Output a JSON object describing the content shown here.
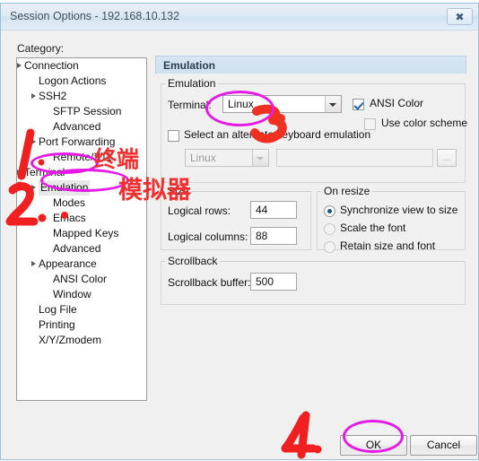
{
  "window": {
    "title": "Session Options  -  192.168.10.132",
    "close_icon": "close-icon",
    "close_glyph": "✖"
  },
  "sidebar": {
    "label": "Category:",
    "items": [
      {
        "label": "Connection",
        "depth": 0,
        "expander": true,
        "selected": false
      },
      {
        "label": "Logon Actions",
        "depth": 1,
        "expander": false,
        "selected": false
      },
      {
        "label": "SSH2",
        "depth": 1,
        "expander": true,
        "selected": false
      },
      {
        "label": "SFTP Session",
        "depth": 2,
        "expander": false,
        "selected": false
      },
      {
        "label": "Advanced",
        "depth": 2,
        "expander": false,
        "selected": false
      },
      {
        "label": "Port Forwarding",
        "depth": 1,
        "expander": true,
        "selected": false
      },
      {
        "label": "Remote/X11",
        "depth": 2,
        "expander": false,
        "selected": false
      },
      {
        "label": "Terminal",
        "depth": 0,
        "expander": true,
        "selected": false
      },
      {
        "label": "Emulation",
        "depth": 1,
        "expander": true,
        "selected": true
      },
      {
        "label": "Modes",
        "depth": 2,
        "expander": false,
        "selected": false
      },
      {
        "label": "Emacs",
        "depth": 2,
        "expander": false,
        "selected": false
      },
      {
        "label": "Mapped Keys",
        "depth": 2,
        "expander": false,
        "selected": false
      },
      {
        "label": "Advanced",
        "depth": 2,
        "expander": false,
        "selected": false
      },
      {
        "label": "Appearance",
        "depth": 1,
        "expander": true,
        "selected": false
      },
      {
        "label": "ANSI Color",
        "depth": 2,
        "expander": false,
        "selected": false
      },
      {
        "label": "Window",
        "depth": 2,
        "expander": false,
        "selected": false
      },
      {
        "label": "Log File",
        "depth": 1,
        "expander": false,
        "selected": false
      },
      {
        "label": "Printing",
        "depth": 1,
        "expander": false,
        "selected": false
      },
      {
        "label": "X/Y/Zmodem",
        "depth": 1,
        "expander": false,
        "selected": false
      }
    ]
  },
  "panel": {
    "header": "Emulation",
    "emulation_group": {
      "legend": "Emulation",
      "terminal_label": "Terminal:",
      "terminal_value": "Linux",
      "ansi_color_label": "ANSI Color",
      "ansi_color_checked": true,
      "use_color_scheme_label": "Use color scheme",
      "use_color_scheme_checked": false,
      "alt_keyboard_label": "Select an alternate keyboard emulation",
      "alt_keyboard_checked": false,
      "alt_keyboard_value": "Linux",
      "alt_keyboard_path": "",
      "browse_label": "..."
    },
    "size_group": {
      "legend": "Size",
      "rows_label": "Logical rows:",
      "rows_value": "44",
      "cols_label": "Logical columns:",
      "cols_value": "88"
    },
    "resize_group": {
      "legend": "On resize",
      "options": [
        {
          "label": "Synchronize view to size",
          "selected": true,
          "enabled": true
        },
        {
          "label": "Scale the font",
          "selected": false,
          "enabled": false
        },
        {
          "label": "Retain size and font",
          "selected": false,
          "enabled": false
        }
      ]
    },
    "scrollback_group": {
      "legend": "Scrollback",
      "buffer_label": "Scrollback buffer:",
      "buffer_value": "500"
    }
  },
  "footer": {
    "ok_label": "OK",
    "cancel_label": "Cancel"
  },
  "annotations": {
    "step1": "1.",
    "step2": "2.",
    "step3": "3.",
    "step4": "4.",
    "cjk_line1": "终端",
    "cjk_line2": "模拟器",
    "highlight_color": "#e619e6",
    "pen_color": "#f02020"
  }
}
